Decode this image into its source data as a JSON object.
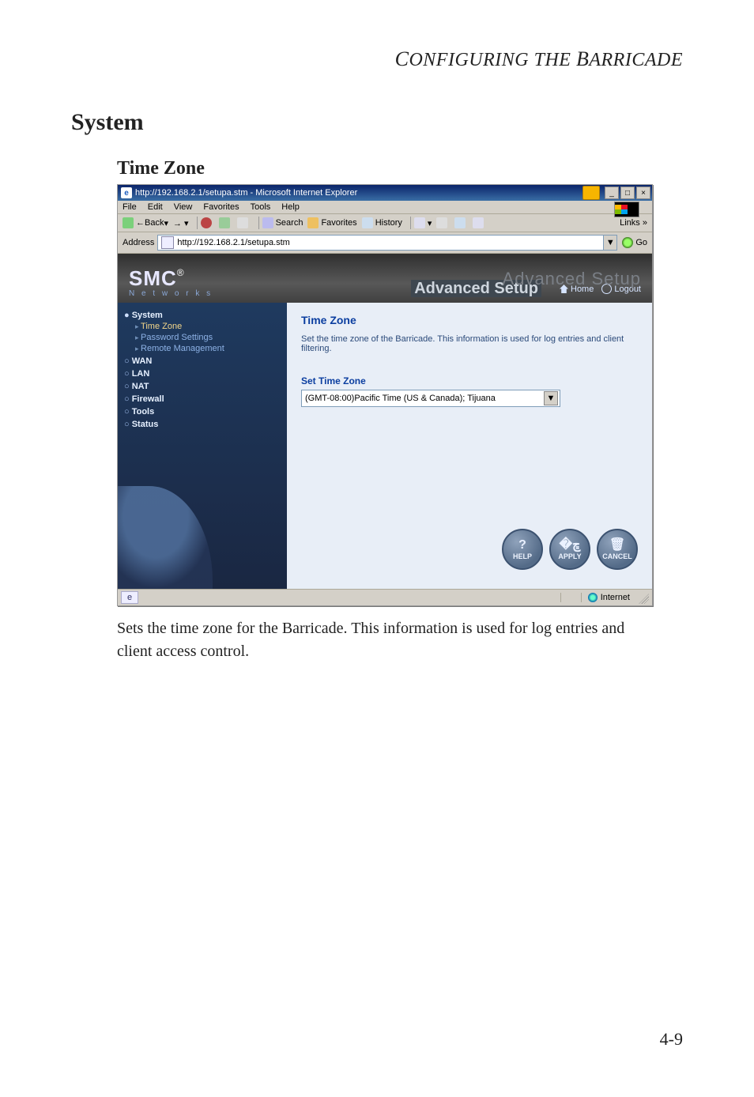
{
  "doc": {
    "running_head": "CONFIGURING THE BARRICADE",
    "section": "System",
    "subsection": "Time Zone",
    "body_text": "Sets the time zone for the Barricade. This information is used for log entries and client access control.",
    "page_number": "4-9"
  },
  "browser": {
    "title": "http://192.168.2.1/setupa.stm - Microsoft Internet Explorer",
    "menus": [
      "File",
      "Edit",
      "View",
      "Favorites",
      "Tools",
      "Help"
    ],
    "toolbar": {
      "back": "Back",
      "search": "Search",
      "favorites": "Favorites",
      "history": "History",
      "links": "Links"
    },
    "address_label": "Address",
    "address_value": "http://192.168.2.1/setupa.stm",
    "go_label": "Go",
    "status_zone": "Internet"
  },
  "app": {
    "brand": "SMC",
    "brand_sub": "N e t w o r k s",
    "ghost": "Advanced Setup",
    "adv_setup": "Advanced Setup",
    "top_links": {
      "home": "Home",
      "logout": "Logout"
    },
    "sidebar": {
      "groups": [
        {
          "label": "System",
          "expanded": true,
          "items": [
            {
              "label": "Time Zone",
              "active": true
            },
            {
              "label": "Password Settings",
              "active": false
            },
            {
              "label": "Remote Management",
              "active": false
            }
          ]
        },
        {
          "label": "WAN",
          "expanded": false
        },
        {
          "label": "LAN",
          "expanded": false
        },
        {
          "label": "NAT",
          "expanded": false
        },
        {
          "label": "Firewall",
          "expanded": false
        },
        {
          "label": "Tools",
          "expanded": false
        },
        {
          "label": "Status",
          "expanded": false
        }
      ]
    },
    "content": {
      "heading": "Time Zone",
      "description": "Set the time zone of the Barricade. This information is used for log entries and client filtering.",
      "set_label": "Set Time Zone",
      "select_value": "(GMT-08:00)Pacific Time (US & Canada); Tijuana"
    },
    "buttons": {
      "help": "HELP",
      "apply": "APPLY",
      "cancel": "CANCEL"
    }
  }
}
